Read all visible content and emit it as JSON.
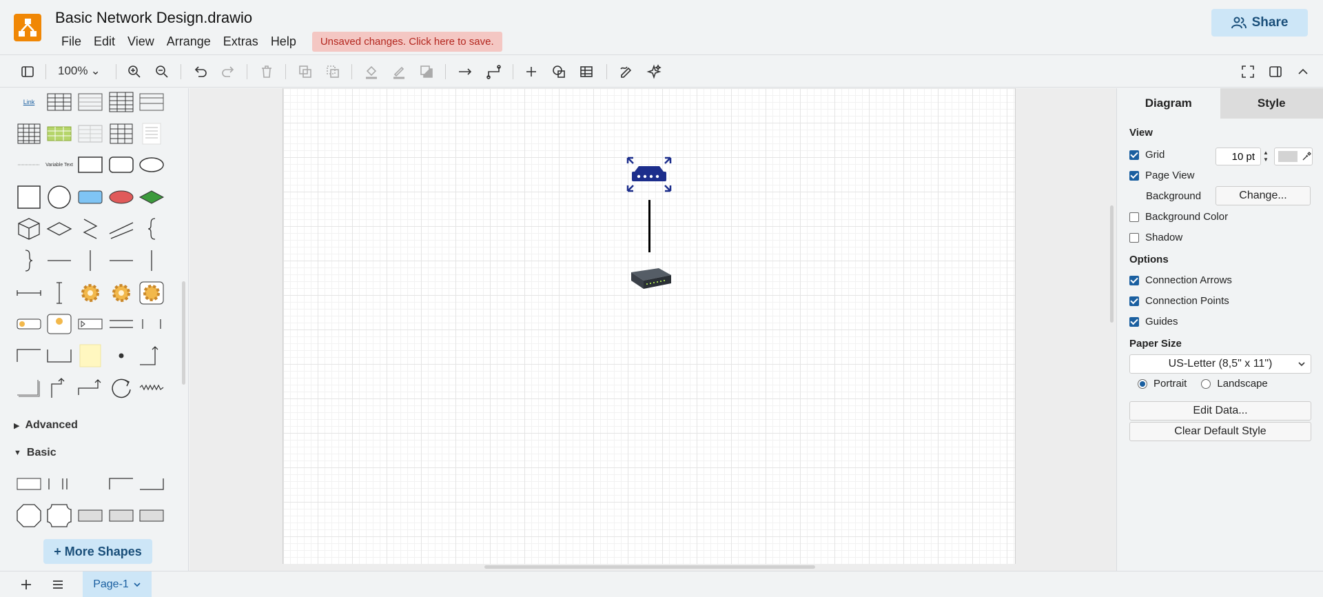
{
  "app": {
    "title": "Basic Network Design.drawio",
    "menus": [
      "File",
      "Edit",
      "View",
      "Arrange",
      "Extras",
      "Help"
    ],
    "unsaved_notice": "Unsaved changes. Click here to save.",
    "share_label": "Share",
    "accent": "#f08705"
  },
  "toolbar": {
    "zoom": "100%"
  },
  "left_panel": {
    "link_label": "Link",
    "variable_text": "Variable Text",
    "sections": {
      "advanced": "Advanced",
      "basic": "Basic"
    },
    "more_shapes": "+ More Shapes"
  },
  "diagram": {
    "nodes": [
      {
        "name": "router",
        "icon": "router-icon"
      },
      {
        "name": "switch",
        "icon": "network-switch-image"
      }
    ],
    "edges": [
      {
        "from": "router",
        "to": "switch"
      }
    ]
  },
  "format_panel": {
    "tabs": [
      "Diagram",
      "Style"
    ],
    "view_heading": "View",
    "grid_label": "Grid",
    "grid_size": "10 pt",
    "page_view_label": "Page View",
    "background_label": "Background",
    "change_label": "Change...",
    "background_color_label": "Background Color",
    "shadow_label": "Shadow",
    "options_heading": "Options",
    "connection_arrows_label": "Connection Arrows",
    "connection_points_label": "Connection Points",
    "guides_label": "Guides",
    "paper_size_heading": "Paper Size",
    "paper_size_value": "US-Letter (8,5\" x 11\")",
    "portrait_label": "Portrait",
    "landscape_label": "Landscape",
    "edit_data_label": "Edit Data...",
    "clear_style_label": "Clear Default Style"
  },
  "footer": {
    "page_tab": "Page-1"
  }
}
